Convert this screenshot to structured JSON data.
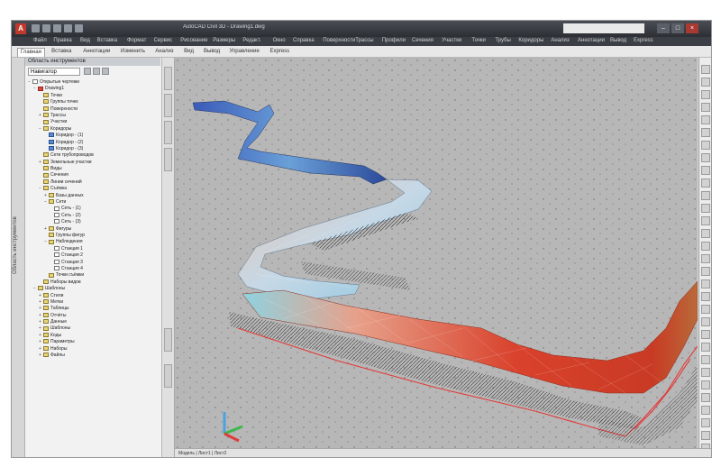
{
  "window": {
    "app_logo": "A",
    "title": "AutoCAD Civil 3D - Drawing1.dwg",
    "search_placeholder": "",
    "controls": [
      "–",
      "□",
      "×"
    ]
  },
  "menu": {
    "items": [
      "Файл",
      "Правка",
      "Вид",
      "Вставка",
      "Формат",
      "Сервис",
      "Рисование",
      "Размеры",
      "Редакт.",
      "Окно",
      "Справка",
      "Поверхности",
      "Трассы",
      "Профили",
      "Сечения",
      "Участки",
      "Точки",
      "Трубы",
      "Коридоры",
      "Анализ",
      "Аннотации",
      "Вывод",
      "Express"
    ]
  },
  "tabs": {
    "items": [
      "Главная",
      "Вставка",
      "Аннотации",
      "Изменить",
      "Анализ",
      "Вид",
      "Вывод",
      "Управление",
      "Express"
    ],
    "active_index": 0
  },
  "toolspace": {
    "header": "Область инструментов",
    "vertical_label": "Область инструментов",
    "view_dropdown": "Навигатор",
    "tree": [
      {
        "indent": 0,
        "exp": "−",
        "icon": "doc",
        "label": "Открытые чертежи"
      },
      {
        "indent": 1,
        "exp": "−",
        "icon": "red",
        "label": "Drawing1"
      },
      {
        "indent": 2,
        "exp": "",
        "icon": "folder",
        "label": "Точки"
      },
      {
        "indent": 2,
        "exp": "",
        "icon": "folder",
        "label": "Группы точек"
      },
      {
        "indent": 2,
        "exp": "",
        "icon": "folder",
        "label": "Поверхности"
      },
      {
        "indent": 2,
        "exp": "+",
        "icon": "folder",
        "label": "Трассы"
      },
      {
        "indent": 2,
        "exp": "",
        "icon": "folder",
        "label": "Участки"
      },
      {
        "indent": 2,
        "exp": "−",
        "icon": "folder",
        "label": "Коридоры"
      },
      {
        "indent": 3,
        "exp": "",
        "icon": "blue",
        "label": "Коридор - (1)"
      },
      {
        "indent": 3,
        "exp": "",
        "icon": "blue",
        "label": "Коридор - (2)"
      },
      {
        "indent": 3,
        "exp": "",
        "icon": "blue",
        "label": "Коридор - (3)"
      },
      {
        "indent": 2,
        "exp": "",
        "icon": "folder",
        "label": "Сети трубопроводов"
      },
      {
        "indent": 2,
        "exp": "+",
        "icon": "folder",
        "label": "Земельные участки"
      },
      {
        "indent": 2,
        "exp": "",
        "icon": "folder",
        "label": "Виды"
      },
      {
        "indent": 2,
        "exp": "",
        "icon": "folder",
        "label": "Сечения"
      },
      {
        "indent": 2,
        "exp": "",
        "icon": "folder",
        "label": "Линии сечений"
      },
      {
        "indent": 2,
        "exp": "−",
        "icon": "folder",
        "label": "Съёмка"
      },
      {
        "indent": 3,
        "exp": "+",
        "icon": "folder",
        "label": "Базы данных"
      },
      {
        "indent": 3,
        "exp": "−",
        "icon": "folder",
        "label": "Сети"
      },
      {
        "indent": 4,
        "exp": "",
        "icon": "doc",
        "label": "Сеть - (1)"
      },
      {
        "indent": 4,
        "exp": "",
        "icon": "doc",
        "label": "Сеть - (2)"
      },
      {
        "indent": 4,
        "exp": "",
        "icon": "doc",
        "label": "Сеть - (3)"
      },
      {
        "indent": 3,
        "exp": "+",
        "icon": "folder",
        "label": "Фигуры"
      },
      {
        "indent": 3,
        "exp": "",
        "icon": "folder",
        "label": "Группы фигур"
      },
      {
        "indent": 3,
        "exp": "−",
        "icon": "folder",
        "label": "Наблюдения"
      },
      {
        "indent": 4,
        "exp": "",
        "icon": "doc",
        "label": "Станция 1"
      },
      {
        "indent": 4,
        "exp": "",
        "icon": "doc",
        "label": "Станция 2"
      },
      {
        "indent": 4,
        "exp": "",
        "icon": "doc",
        "label": "Станция 3"
      },
      {
        "indent": 4,
        "exp": "",
        "icon": "doc",
        "label": "Станция 4"
      },
      {
        "indent": 3,
        "exp": "",
        "icon": "folder",
        "label": "Точки съёмки"
      },
      {
        "indent": 2,
        "exp": "",
        "icon": "folder",
        "label": "Наборы видов"
      },
      {
        "indent": 1,
        "exp": "−",
        "icon": "folder",
        "label": "Шаблоны"
      },
      {
        "indent": 2,
        "exp": "+",
        "icon": "folder",
        "label": "Стили"
      },
      {
        "indent": 2,
        "exp": "+",
        "icon": "folder",
        "label": "Метки"
      },
      {
        "indent": 2,
        "exp": "+",
        "icon": "folder",
        "label": "Таблицы"
      },
      {
        "indent": 2,
        "exp": "+",
        "icon": "folder",
        "label": "Отчёты"
      },
      {
        "indent": 2,
        "exp": "+",
        "icon": "folder",
        "label": "Данные"
      },
      {
        "indent": 2,
        "exp": "+",
        "icon": "folder",
        "label": "Шаблоны"
      },
      {
        "indent": 2,
        "exp": "+",
        "icon": "folder",
        "label": "Коды"
      },
      {
        "indent": 2,
        "exp": "+",
        "icon": "folder",
        "label": "Параметры"
      },
      {
        "indent": 2,
        "exp": "+",
        "icon": "folder",
        "label": "Наборы"
      },
      {
        "indent": 2,
        "exp": "+",
        "icon": "folder",
        "label": "Файлы"
      }
    ]
  },
  "status": {
    "text": "Модель  |  Лист1  |  Лист2"
  },
  "colors": {
    "viewport_bg": "#b7b7b7",
    "surface_red": "#d9422c",
    "surface_blue": "#3a6fc4",
    "edge_red": "#e23a3a"
  }
}
